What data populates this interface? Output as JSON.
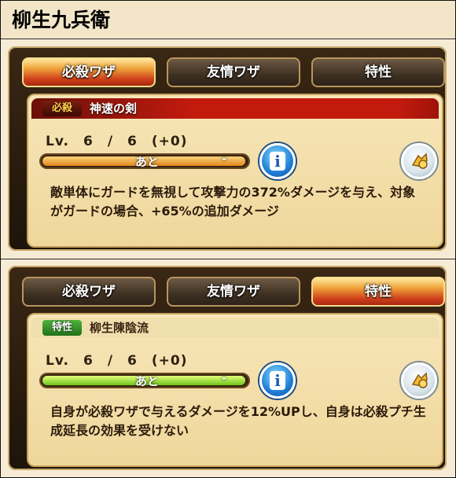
{
  "header": {
    "title": "柳生九兵衛"
  },
  "tabs": [
    "必殺ワザ",
    "友情ワザ",
    "特性"
  ],
  "panels": [
    {
      "active_tab": "必殺ワザ",
      "badge": "必殺",
      "skill_name": "神速の剣",
      "level": "Lv.　6　/　6　(+0)",
      "gauge_label": "あと",
      "gauge_tail": "-",
      "description": "敵単体にガードを無視して攻撃力の372%ダメージを与え、対象がガードの場合、+65%の追加ダメージ",
      "progress": 1.0,
      "colors": {
        "badge": "#6b1008",
        "fill": "#e4861d"
      }
    },
    {
      "active_tab": "特性",
      "badge": "特性",
      "skill_name": "柳生陳陰流",
      "level": "Lv.　6　/　6　(+0)",
      "gauge_label": "あと",
      "gauge_tail": "-",
      "description": "自身が必殺ワザで与えるダメージを12%UPし、自身は必殺プチ生成延長の効果を受けない",
      "progress": 1.0,
      "colors": {
        "badge": "#21701a",
        "fill": "#6cc51c"
      }
    }
  ],
  "icons": {
    "info": "info-icon",
    "power": "power-icon"
  }
}
